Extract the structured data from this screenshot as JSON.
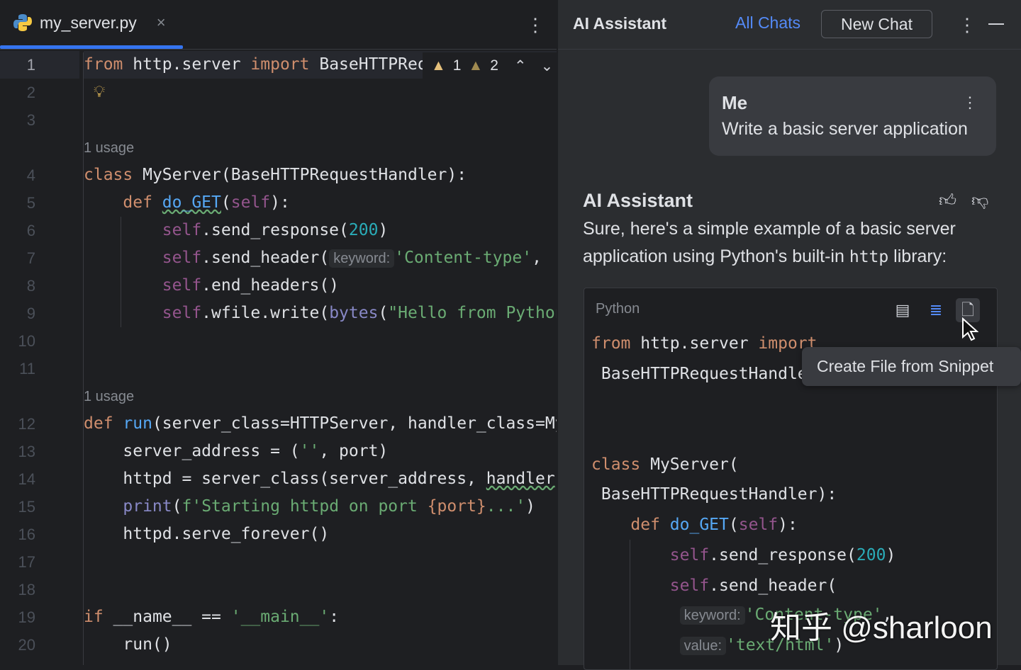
{
  "editor": {
    "tab": {
      "filename": "my_server.py",
      "close": "×",
      "icon": "python-icon"
    },
    "menu_icon": "⋮",
    "inspections": {
      "warnings": "1",
      "weak_warnings": "2"
    },
    "rows": [
      {
        "n": "1",
        "t": [
          [
            "from",
            "kw"
          ],
          " http.server ",
          [
            "import",
            "kw"
          ],
          " BaseHTTPRequestHandler, HTTPServer"
        ]
      },
      {
        "n": "2",
        "t": [],
        "bulb": true
      },
      {
        "n": "3",
        "t": []
      },
      {
        "usage": "1 usage"
      },
      {
        "n": "4",
        "t": [
          [
            "class",
            "kw"
          ],
          " MyServer(BaseHTTPRequestHandler):"
        ]
      },
      {
        "n": "5",
        "t": [
          "    ",
          [
            "def",
            "kw"
          ],
          " ",
          [
            "do_GET",
            "fn und"
          ],
          "(",
          [
            "self",
            "slf"
          ],
          "):"
        ]
      },
      {
        "n": "6",
        "t": [
          "        ",
          [
            "self",
            "slf"
          ],
          ".send_response(",
          [
            "200",
            "num"
          ],
          ")"
        ]
      },
      {
        "n": "7",
        "t": [
          "        ",
          [
            "self",
            "slf"
          ],
          ".send_header(",
          [
            "keyword:",
            "hint"
          ],
          [
            "'Content-type'",
            "str"
          ],
          ", "
        ]
      },
      {
        "n": "8",
        "t": [
          "        ",
          [
            "self",
            "slf"
          ],
          ".end_headers()"
        ]
      },
      {
        "n": "9",
        "t": [
          "        ",
          [
            "self",
            "slf"
          ],
          ".wfile.write(",
          [
            "bytes",
            "bi"
          ],
          "(",
          [
            "\"Hello from Python\"",
            "str"
          ]
        ]
      },
      {
        "n": "10",
        "t": []
      },
      {
        "n": "11",
        "t": []
      },
      {
        "usage": "1 usage"
      },
      {
        "n": "12",
        "t": [
          [
            "def",
            "kw"
          ],
          " ",
          [
            "run",
            "fn"
          ],
          "(server_class=HTTPServer, handler_class=MyServer"
        ]
      },
      {
        "n": "13",
        "t": [
          "    server_address = (",
          [
            "''",
            "str"
          ],
          ", port)"
        ]
      },
      {
        "n": "14",
        "t": [
          "    httpd = server_class(server_address, ",
          [
            "handler",
            "und"
          ]
        ]
      },
      {
        "n": "15",
        "t": [
          "    ",
          [
            "print",
            "bi"
          ],
          "(",
          [
            "f'Starting httpd on port ",
            "str"
          ],
          [
            "{port}",
            "kw"
          ],
          [
            "...'",
            "str"
          ],
          ")"
        ]
      },
      {
        "n": "16",
        "t": [
          "    httpd.serve_forever()"
        ]
      },
      {
        "n": "17",
        "t": []
      },
      {
        "n": "18",
        "t": []
      },
      {
        "n": "19",
        "t": [
          [
            "if",
            "kw"
          ],
          " __name__ == ",
          [
            "'__main__'",
            "str"
          ],
          ":"
        ],
        "run": true
      },
      {
        "n": "20",
        "t": [
          "    run()"
        ]
      }
    ]
  },
  "assistant": {
    "title": "AI Assistant",
    "all_chats": "All Chats",
    "new_chat": "New Chat",
    "user_message": {
      "author": "Me",
      "text": "Write a basic server application"
    },
    "reply": {
      "author": "AI Assistant",
      "text_before": "Sure, here's a simple example of a basic server application using Python's built-in ",
      "code": "http",
      "text_after": " library:"
    },
    "snippet": {
      "language": "Python",
      "lines": [
        [
          [
            "from",
            "kw"
          ],
          " http.server ",
          [
            "import",
            "kw"
          ]
        ],
        [
          " BaseHTTPRequestHandler, HTTPServer"
        ],
        [
          [
            "class",
            "kw"
          ],
          " MyServer("
        ],
        [
          " BaseHTTPRequestHandler):"
        ],
        [
          "    ",
          [
            "def",
            "kw"
          ],
          " ",
          [
            "do_GET",
            "fn"
          ],
          "(",
          [
            "self",
            "slf"
          ],
          "):"
        ],
        [
          "        ",
          [
            "self",
            "slf"
          ],
          ".send_response(",
          [
            "200",
            "num"
          ],
          ")"
        ],
        [
          "        ",
          [
            "self",
            "slf"
          ],
          ".send_header("
        ],
        [
          "         ",
          [
            "keyword:",
            "hint"
          ],
          [
            "'Content-type'",
            "str"
          ],
          ","
        ],
        [
          "         ",
          [
            "value:",
            "hint"
          ],
          [
            "'text/html'",
            "str"
          ],
          ")"
        ]
      ]
    },
    "tooltip": "Create File from Snippet"
  },
  "watermark": "知乎 @sharloon"
}
